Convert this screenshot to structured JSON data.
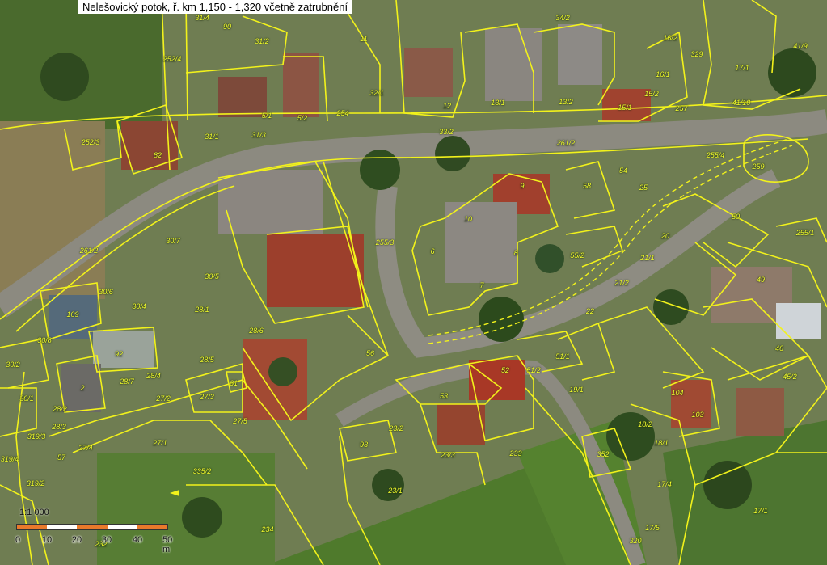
{
  "title": "Nelešovický potok, ř. km 1,150 - 1,320 včetně zatrubnění",
  "colors": {
    "parcel_line": "#f2f21b",
    "label": "#f4ff2e",
    "road": "#8c8a80",
    "field": "#4f7a2c",
    "roof": "#9c3f2c",
    "scale_orange": "#e9792b"
  },
  "parcels": [
    {
      "id": "p90",
      "text": "90"
    },
    {
      "id": "p31_4",
      "text": "31/4"
    },
    {
      "id": "p31_2",
      "text": "31/2"
    },
    {
      "id": "p252_4",
      "text": "252/4"
    },
    {
      "id": "p11",
      "text": "11"
    },
    {
      "id": "p34_2",
      "text": "34/2"
    },
    {
      "id": "p16_2",
      "text": "16/2"
    },
    {
      "id": "p329",
      "text": "329"
    },
    {
      "id": "p41_9",
      "text": "41/9"
    },
    {
      "id": "p17_1",
      "text": "17/1"
    },
    {
      "id": "p16_1",
      "text": "16/1"
    },
    {
      "id": "p32_1",
      "text": "32/1"
    },
    {
      "id": "p12",
      "text": "12"
    },
    {
      "id": "p13_1",
      "text": "13/1"
    },
    {
      "id": "p13_2",
      "text": "13/2"
    },
    {
      "id": "p15_2",
      "text": "15/2"
    },
    {
      "id": "p15_1",
      "text": "15/1"
    },
    {
      "id": "p257",
      "text": "257"
    },
    {
      "id": "p41_10",
      "text": "41/10"
    },
    {
      "id": "p5_1",
      "text": "5/1"
    },
    {
      "id": "p5_2",
      "text": "5/2"
    },
    {
      "id": "p254",
      "text": "254"
    },
    {
      "id": "p31_1",
      "text": "31/1"
    },
    {
      "id": "p31_3",
      "text": "31/3"
    },
    {
      "id": "p33_2",
      "text": "33/2"
    },
    {
      "id": "p252_3",
      "text": "252/3"
    },
    {
      "id": "p82",
      "text": "82"
    },
    {
      "id": "p261_2a",
      "text": "261/2"
    },
    {
      "id": "p255_4",
      "text": "255/4"
    },
    {
      "id": "p259",
      "text": "259"
    },
    {
      "id": "p9",
      "text": "9"
    },
    {
      "id": "p58",
      "text": "58"
    },
    {
      "id": "p54",
      "text": "54"
    },
    {
      "id": "p25",
      "text": "25"
    },
    {
      "id": "p50",
      "text": "50"
    },
    {
      "id": "p255_1",
      "text": "255/1"
    },
    {
      "id": "p10",
      "text": "10"
    },
    {
      "id": "p255_3",
      "text": "255/3"
    },
    {
      "id": "p6",
      "text": "6"
    },
    {
      "id": "p8",
      "text": "8"
    },
    {
      "id": "p55_2",
      "text": "55/2"
    },
    {
      "id": "p20",
      "text": "20"
    },
    {
      "id": "p21_1",
      "text": "21/1"
    },
    {
      "id": "p7",
      "text": "7"
    },
    {
      "id": "p21_2",
      "text": "21/2"
    },
    {
      "id": "p49",
      "text": "49"
    },
    {
      "id": "p30_7",
      "text": "30/7"
    },
    {
      "id": "p261_2b",
      "text": "261/2"
    },
    {
      "id": "p30_5",
      "text": "30/5"
    },
    {
      "id": "p30_6",
      "text": "30/6"
    },
    {
      "id": "p30_4",
      "text": "30/4"
    },
    {
      "id": "p28_1",
      "text": "28/1"
    },
    {
      "id": "p109",
      "text": "109"
    },
    {
      "id": "p30_8",
      "text": "30/8"
    },
    {
      "id": "p28_6",
      "text": "28/6"
    },
    {
      "id": "p92",
      "text": "92"
    },
    {
      "id": "p28_5",
      "text": "28/5"
    },
    {
      "id": "p56",
      "text": "56"
    },
    {
      "id": "p22",
      "text": "22"
    },
    {
      "id": "p51_1",
      "text": "51/1"
    },
    {
      "id": "p46",
      "text": "46"
    },
    {
      "id": "p30_2",
      "text": "30/2"
    },
    {
      "id": "p28_7",
      "text": "28/7"
    },
    {
      "id": "p28_4",
      "text": "28/4"
    },
    {
      "id": "p61",
      "text": "61"
    },
    {
      "id": "p52",
      "text": "52"
    },
    {
      "id": "p51_2",
      "text": "51/2"
    },
    {
      "id": "p19_1",
      "text": "19/1"
    },
    {
      "id": "p45_2",
      "text": "45/2"
    },
    {
      "id": "p30_1",
      "text": "30/1"
    },
    {
      "id": "p2",
      "text": "2"
    },
    {
      "id": "p28_2",
      "text": "28/2"
    },
    {
      "id": "p27_2",
      "text": "27/2"
    },
    {
      "id": "p27_3",
      "text": "27/3"
    },
    {
      "id": "p53",
      "text": "53"
    },
    {
      "id": "p104",
      "text": "104"
    },
    {
      "id": "p103",
      "text": "103"
    },
    {
      "id": "p28_3",
      "text": "28/3"
    },
    {
      "id": "p27_5",
      "text": "27/5"
    },
    {
      "id": "p23_2",
      "text": "23/2"
    },
    {
      "id": "p18_2",
      "text": "18/2"
    },
    {
      "id": "p319_3",
      "text": "319/3"
    },
    {
      "id": "p27_4",
      "text": "27/4"
    },
    {
      "id": "p27_1",
      "text": "27/1"
    },
    {
      "id": "p93",
      "text": "93"
    },
    {
      "id": "p23_3",
      "text": "23/3"
    },
    {
      "id": "p233",
      "text": "233"
    },
    {
      "id": "p352",
      "text": "352"
    },
    {
      "id": "p18_1",
      "text": "18/1"
    },
    {
      "id": "p319_4",
      "text": "319/4"
    },
    {
      "id": "p57",
      "text": "57"
    },
    {
      "id": "p335_2",
      "text": "335/2"
    },
    {
      "id": "p319_2",
      "text": "319/2"
    },
    {
      "id": "p23_1",
      "text": "23/1"
    },
    {
      "id": "p17_4",
      "text": "17/4"
    },
    {
      "id": "p17_1b",
      "text": "17/1"
    },
    {
      "id": "p234",
      "text": "234"
    },
    {
      "id": "p17_5",
      "text": "17/5"
    },
    {
      "id": "p320",
      "text": "320"
    },
    {
      "id": "p232",
      "text": "232"
    }
  ],
  "scale": {
    "ratio": "1:1 000",
    "ticks": [
      "0",
      "10",
      "20",
      "30",
      "40",
      "50 m"
    ]
  }
}
